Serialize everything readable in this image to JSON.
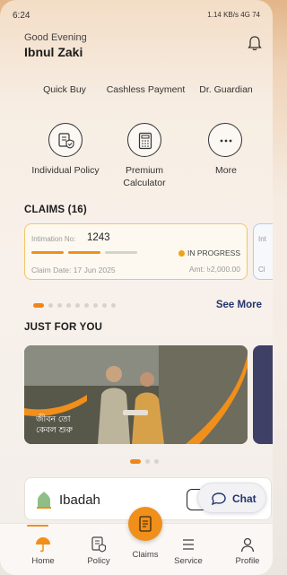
{
  "status_bar": {
    "time": "6:24",
    "right_text": "1.14 KB/s 4G 74"
  },
  "header": {
    "greeting": "Good Evening",
    "user_name": "Ibnul Zaki"
  },
  "quick_actions": [
    {
      "label": "Quick Buy",
      "icon": "quick-buy"
    },
    {
      "label": "Cashless Payment",
      "icon": "cashless-payment"
    },
    {
      "label": "Dr. Guardian",
      "icon": "dr-guardian"
    },
    {
      "label": "Individual Policy",
      "icon": "document-shield-icon"
    },
    {
      "label": "Premium Calculator",
      "icon": "calculator-icon"
    },
    {
      "label": "More",
      "icon": "more-dots-icon"
    }
  ],
  "claims": {
    "title": "CLAIMS (16)",
    "card": {
      "intimation_label": "Intimation No:",
      "intimation_no": "1243",
      "status": "IN PROGRESS",
      "claim_date": "Claim Date: 17 Jun 2025",
      "amount": "Amt: ৳2,000.00",
      "progress_steps_done": 2,
      "progress_steps_total": 3
    },
    "second_card_prefix": {
      "top": "Int",
      "bottom": "Cl"
    },
    "see_more": "See More",
    "pager_count": 9,
    "pager_active": 0
  },
  "just_for_you": {
    "title": "JUST FOR YOU",
    "banner_text_line1": "জীবন তো",
    "banner_text_line2": "কেবল শুরু",
    "pager_count": 3,
    "pager_active": 0
  },
  "ibadah": {
    "label": "Ibadah"
  },
  "chat": {
    "label": "Chat"
  },
  "bottom_nav": [
    {
      "label": "Home",
      "icon": "umbrella-icon"
    },
    {
      "label": "Policy",
      "icon": "policy-icon"
    },
    {
      "label": "Claims",
      "icon": "claims-icon"
    },
    {
      "label": "Service",
      "icon": "service-icon"
    },
    {
      "label": "Profile",
      "icon": "profile-icon"
    }
  ],
  "colors": {
    "accent": "#f08f1a",
    "navy": "#24346f",
    "claim_border": "#f1c56b"
  }
}
